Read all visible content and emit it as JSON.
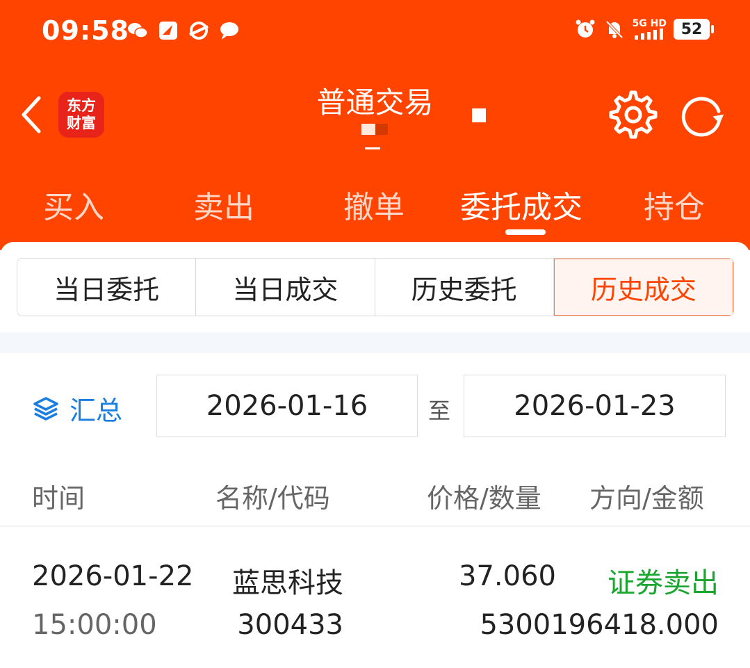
{
  "status_bar": {
    "time": "09:58",
    "left_icons": [
      "wechat-icon",
      "app-icon",
      "app-icon",
      "chat-bubble-icon"
    ],
    "right_icons": [
      "alarm-icon",
      "mute-bell-icon",
      "signal-5g-icon"
    ],
    "network": "5G HD",
    "battery": "52"
  },
  "nav": {
    "logo_line1": "东方",
    "logo_line2": "财富",
    "title": "普通交易",
    "icons": [
      "back-chevron-icon",
      "gear-icon",
      "refresh-icon"
    ]
  },
  "tabs": [
    "买入",
    "卖出",
    "撤单",
    "委托成交",
    "持仓"
  ],
  "active_tab": "委托成交",
  "segments": [
    "当日委托",
    "当日成交",
    "历史委托",
    "历史成交"
  ],
  "active_segment": "历史成交",
  "filter": {
    "summary_label": "汇总",
    "summary_icon": "layers-icon",
    "start_date": "2026-01-16",
    "separator": "至",
    "end_date": "2026-01-23"
  },
  "table": {
    "headers": [
      "时间",
      "名称/代码",
      "价格/数量",
      "方向/金额"
    ],
    "rows": [
      {
        "date": "2026-01-22",
        "time": "15:00:00",
        "name": "蓝思科技",
        "code": "300433",
        "price": "37.060",
        "amount": "5300196418.000",
        "direction": "证券卖出"
      }
    ]
  },
  "colors": {
    "brand": "#ff4400",
    "link": "#1a7ee0",
    "sell": "#1aa530"
  }
}
